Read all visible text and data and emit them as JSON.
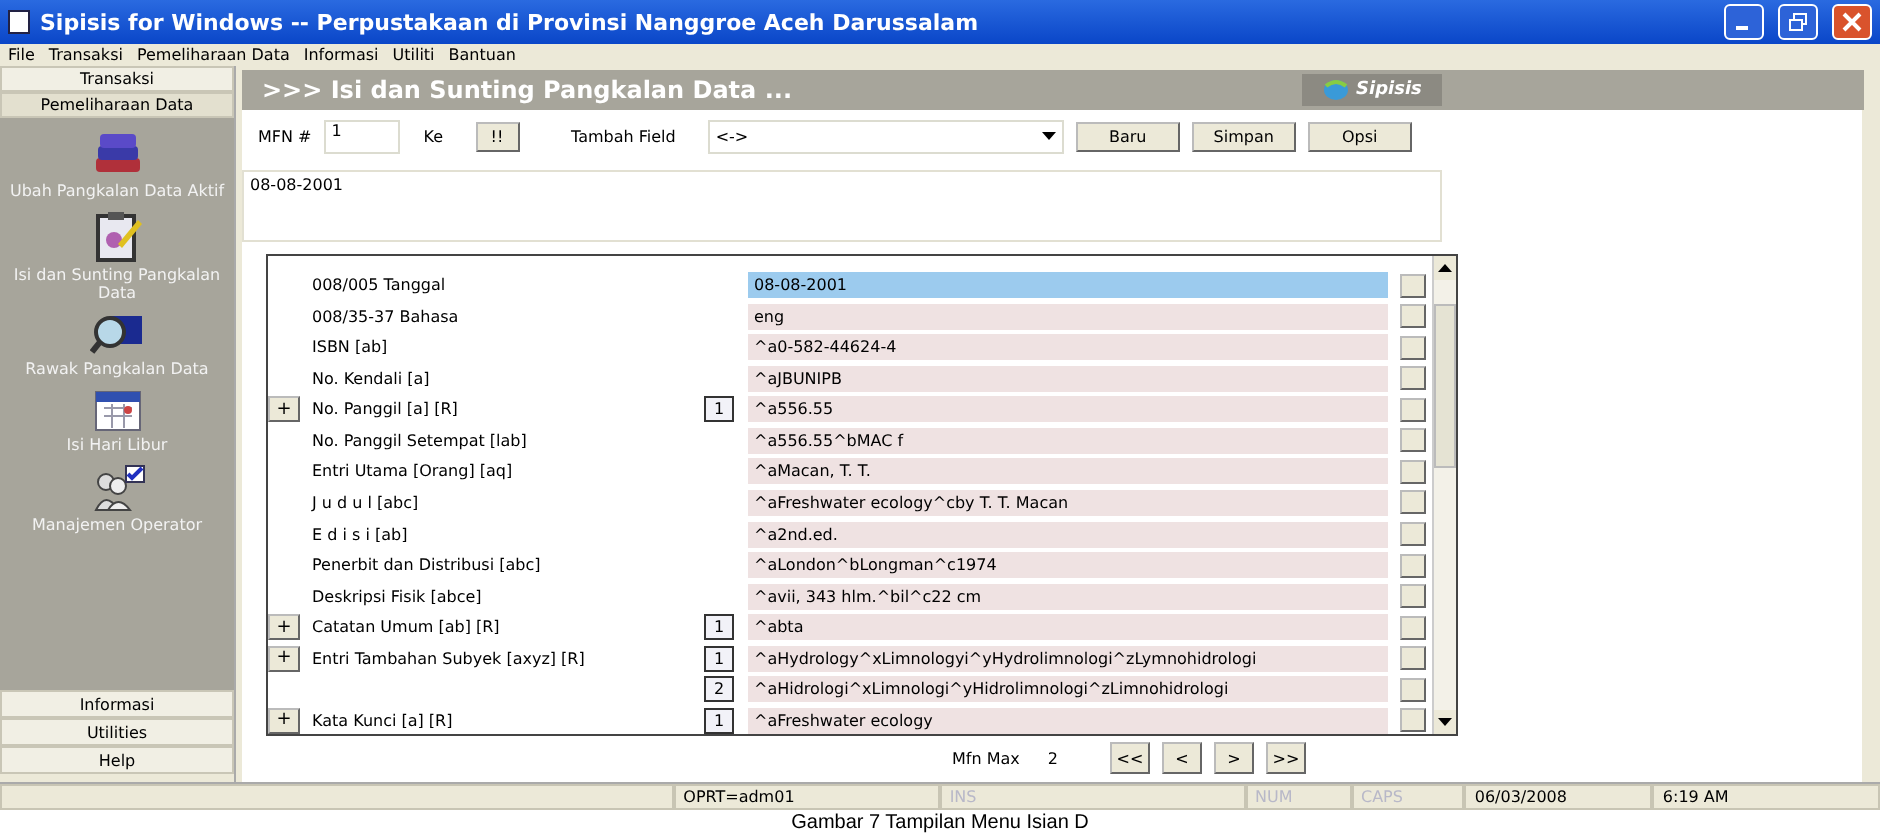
{
  "window": {
    "title": "Sipisis for Windows -- Perpustakaan di Provinsi Nanggroe Aceh Darussalam"
  },
  "menu": [
    "File",
    "Transaksi",
    "Pemeliharaan Data",
    "Informasi",
    "Utiliti",
    "Bantuan"
  ],
  "sidebar": {
    "top_sections": [
      {
        "label": "Transaksi",
        "selected": false
      },
      {
        "label": "Pemeliharaan Data",
        "selected": true
      }
    ],
    "items": [
      {
        "kind": "books",
        "label": "Ubah Pangkalan Data Aktif"
      },
      {
        "kind": "clipboard",
        "label": "Isi dan Sunting Pangkalan Data"
      },
      {
        "kind": "search",
        "label": "Rawak Pangkalan Data"
      },
      {
        "kind": "calendar",
        "label": "Isi Hari Libur"
      },
      {
        "kind": "users",
        "label": "Manajemen Operator"
      }
    ],
    "bottom_sections": [
      "Informasi",
      "Utilities",
      "Help"
    ]
  },
  "header": {
    "title": ">>> Isi dan Sunting Pangkalan Data ...",
    "logo": "Sipisis"
  },
  "toolbar": {
    "mfn_label": "MFN #",
    "mfn_value": "1",
    "ke_label": "Ke",
    "ke_button": "!!",
    "field_label": "Tambah Field",
    "field_value": "<->",
    "buttons": [
      "Baru",
      "Simpan",
      "Opsi"
    ]
  },
  "note": "08-08-2001",
  "fields": [
    {
      "label": "008/005 Tanggal",
      "value": "08-08-2001",
      "selected": true
    },
    {
      "label": "008/35-37 Bahasa",
      "value": "eng",
      "selected": false
    },
    {
      "label": "ISBN [ab]",
      "value": "^a0-582-44624-4",
      "selected": false
    },
    {
      "label": "No. Kendali [a]",
      "value": "^aJBUNIPB",
      "selected": false
    },
    {
      "plus": "+",
      "label": "No. Panggil [a] [R]",
      "index": "1",
      "value": "^a556.55",
      "selected": false
    },
    {
      "label": "No. Panggil Setempat [lab]",
      "value": "^a556.55^bMAC f",
      "selected": false
    },
    {
      "label": "Entri Utama [Orang] [aq]",
      "value": "^aMacan, T. T.",
      "selected": false
    },
    {
      "label": "J u d u l [abc]",
      "value": "^aFreshwater ecology^cby T. T. Macan",
      "selected": false
    },
    {
      "label": "E d i s i [ab]",
      "value": "^a2nd.ed.",
      "selected": false
    },
    {
      "label": "Penerbit dan Distribusi [abc]",
      "value": "^aLondon^bLongman^c1974",
      "selected": false
    },
    {
      "label": "Deskripsi Fisik [abce]",
      "value": "^avii, 343 hlm.^bil^c22 cm",
      "selected": false
    },
    {
      "plus": "+",
      "label": "Catatan Umum [ab] [R]",
      "index": "1",
      "value": "^abta",
      "selected": false
    },
    {
      "plus": "+",
      "label": "Entri Tambahan Subyek [axyz] [R]",
      "index": "1",
      "value": "^aHydrology^xLimnologyi^yHydrolimnologi^zLymnohidrologi",
      "selected": false
    },
    {
      "index": "2",
      "value": "^aHidrologi^xLimnologi^yHidrolimnologi^zLimnohidrologi",
      "selected": false
    },
    {
      "plus": "+",
      "label": "Kata Kunci [a] [R]",
      "index": "1",
      "value": "^aFreshwater ecology",
      "selected": false
    }
  ],
  "pager": {
    "label": "Mfn Max",
    "value": "2",
    "buttons": [
      "<<",
      "<",
      ">",
      ">>"
    ]
  },
  "status_bar": [
    {
      "text": "OPRT=adm01",
      "disabled": false
    },
    {
      "text": "INS",
      "disabled": true
    },
    {
      "text": "NUM",
      "disabled": true
    },
    {
      "text": "CAPS",
      "disabled": true
    },
    {
      "text": "06/03/2008",
      "disabled": false
    },
    {
      "text": "6:19 AM",
      "disabled": false
    }
  ],
  "caption": "Gambar 7 Tampilan Menu Isian D"
}
